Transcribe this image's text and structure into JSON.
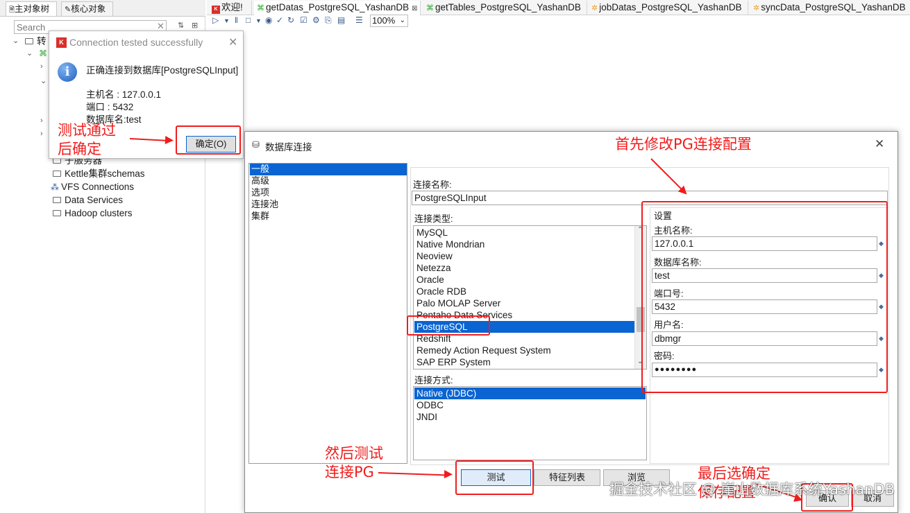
{
  "left_panel": {
    "tabs": [
      "主对象树",
      "核心对象"
    ],
    "search_placeholder": "Search",
    "tree_items": [
      "转",
      "子服务器",
      "Kettle集群schemas",
      "VFS Connections",
      "Data Services",
      "Hadoop clusters"
    ]
  },
  "editor_tabs": [
    {
      "label": "欢迎!"
    },
    {
      "label": "getDatas_PostgreSQL_YashanDB",
      "close": "⊠"
    },
    {
      "label": "getTables_PostgreSQL_YashanDB"
    },
    {
      "label": "jobDatas_PostgreSQL_YashanDB"
    },
    {
      "label": "syncData_PostgreSQL_YashanDB"
    }
  ],
  "toolbar": {
    "zoom": "100%"
  },
  "popup": {
    "title": "Connection tested successfully",
    "message": "正确连接到数据库[PostgreSQLInput]",
    "host_line": "主机名 : 127.0.0.1",
    "port_line": "端口 : 5432",
    "db_line": "数据库名:test",
    "ok_button": "确定(O)",
    "icon": "info-icon"
  },
  "dialog": {
    "title": "数据库连接",
    "nav_items": [
      "一般",
      "高级",
      "选项",
      "连接池",
      "集群"
    ],
    "selected_nav": "一般",
    "conn_name_label": "连接名称:",
    "conn_name_value": "PostgreSQLInput",
    "conn_type_label": "连接类型:",
    "conn_types": [
      "MySQL",
      "Native Mondrian",
      "Neoview",
      "Netezza",
      "Oracle",
      "Oracle RDB",
      "Palo MOLAP Server",
      "Pentaho Data Services",
      "PostgreSQL",
      "Redshift",
      "Remedy Action Request System",
      "SAP ERP System"
    ],
    "selected_type": "PostgreSQL",
    "access_label": "连接方式:",
    "access_types": [
      "Native (JDBC)",
      "ODBC",
      "JNDI"
    ],
    "selected_access": "Native (JDBC)",
    "settings_title": "设置",
    "host_label": "主机名称:",
    "host_value": "127.0.0.1",
    "db_label": "数据库名称:",
    "db_value": "test",
    "port_label": "端口号:",
    "port_value": "5432",
    "user_label": "用户名:",
    "user_value": "dbmgr",
    "password_label": "密码:",
    "password_value": "●●●●●●●●",
    "test_button": "测试",
    "feature_button": "特征列表",
    "explore_button": "浏览",
    "ok_button": "确认",
    "cancel_button": "取消"
  },
  "annotations": {
    "step1": "首先修改PG连接配置",
    "step2_line1": "然后测试",
    "step2_line2": "连接PG",
    "step3_line1": "测试通过",
    "step3_line2": "后确定",
    "step4": "最后选确定",
    "step4_line2": "保存配置",
    "accent_color": "#f01c1c"
  },
  "watermark": "掘金技术社区 @ 崖山数据库系统YashanDB"
}
